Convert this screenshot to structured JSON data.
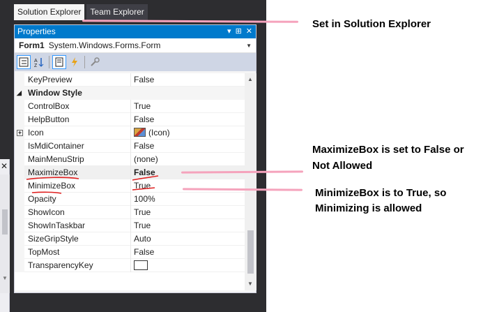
{
  "tabs": [
    {
      "label": "Solution Explorer",
      "active": true
    },
    {
      "label": "Team Explorer",
      "active": false
    }
  ],
  "properties": {
    "title": "Properties",
    "title_buttons": [
      "▾",
      "⊞",
      "✕"
    ],
    "object": {
      "name": "Form1",
      "type": "System.Windows.Forms.Form"
    },
    "toolbar_icons": [
      "categorized-icon",
      "alphabetical-icon",
      "properties-icon",
      "events-icon",
      "property-pages-icon"
    ],
    "rows": [
      {
        "name": "KeyPreview",
        "value": "False"
      },
      {
        "category": "Window Style"
      },
      {
        "name": "ControlBox",
        "value": "True"
      },
      {
        "name": "HelpButton",
        "value": "False"
      },
      {
        "name": "Icon",
        "value": "(Icon)",
        "expandable": true
      },
      {
        "name": "IsMdiContainer",
        "value": "False"
      },
      {
        "name": "MainMenuStrip",
        "value": "(none)"
      },
      {
        "name": "MaximizeBox",
        "value": "False",
        "bold": true,
        "selected": true
      },
      {
        "name": "MinimizeBox",
        "value": "True"
      },
      {
        "name": "Opacity",
        "value": "100%"
      },
      {
        "name": "ShowIcon",
        "value": "True"
      },
      {
        "name": "ShowInTaskbar",
        "value": "True"
      },
      {
        "name": "SizeGripStyle",
        "value": "Auto"
      },
      {
        "name": "TopMost",
        "value": "False"
      },
      {
        "name": "TransparencyKey",
        "value": ""
      }
    ]
  },
  "annotations": {
    "solution_explorer": "Set in Solution Explorer",
    "maximize_line1": "MaximizeBox is set to False or",
    "maximize_line2": "Not Allowed",
    "minimize_line1": "MinimizeBox is to True, so",
    "minimize_line2": "Minimizing is allowed"
  },
  "colors": {
    "accent": "#007acc",
    "ide_dark": "#2d2d30",
    "callout_pink": "#f5a3bc",
    "ink_red": "#e02020"
  }
}
